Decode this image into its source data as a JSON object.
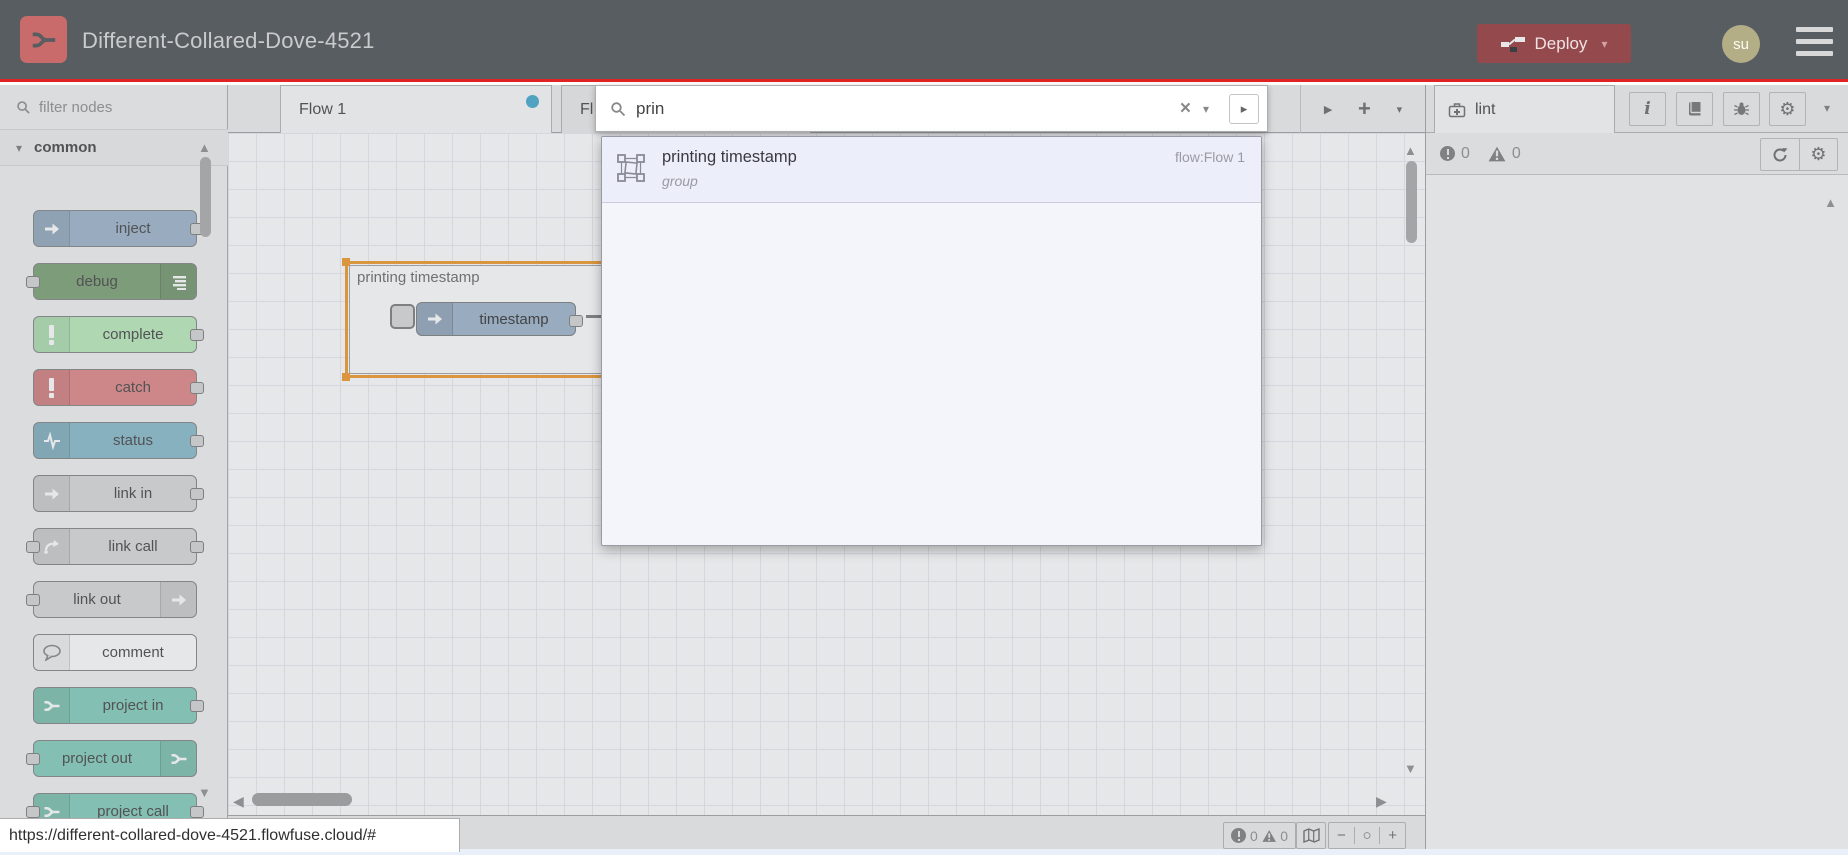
{
  "header": {
    "title": "Different-Collared-Dove-4521",
    "deploy_label": "Deploy",
    "avatar_initials": "su"
  },
  "palette": {
    "filter_placeholder": "filter nodes",
    "category_label": "common",
    "nodes": [
      {
        "label": "inject",
        "color": "#a6bbcf"
      },
      {
        "label": "debug",
        "color": "#87a980"
      },
      {
        "label": "complete",
        "color": "#c0edc0"
      },
      {
        "label": "catch",
        "color": "#e49191"
      },
      {
        "label": "status",
        "color": "#94c1d0"
      },
      {
        "label": "link in",
        "color": "#dddddd"
      },
      {
        "label": "link call",
        "color": "#dddddd"
      },
      {
        "label": "link out",
        "color": "#dddddd"
      },
      {
        "label": "comment",
        "color": "#ffffff"
      },
      {
        "label": "project in",
        "color": "#8ed1c0"
      },
      {
        "label": "project out",
        "color": "#8ed1c0"
      },
      {
        "label": "project call",
        "color": "#8ed1c0"
      }
    ]
  },
  "workspace": {
    "tabs": [
      {
        "label": "Flow 1",
        "unsaved": true
      },
      {
        "label": "Fl"
      }
    ],
    "group": {
      "label": "printing timestamp"
    },
    "node": {
      "label": "timestamp"
    }
  },
  "search": {
    "query": "prin",
    "results": [
      {
        "title": "printing timestamp",
        "type": "group",
        "location": "flow:Flow 1"
      }
    ]
  },
  "sidebar": {
    "tab_label": "lint",
    "error_count": "0",
    "warning_count": "0"
  },
  "canvas_footer": {
    "error_count": "0",
    "warning_count": "0"
  },
  "statusbar": {
    "url": "https://different-collared-dove-4521.flowfuse.cloud/#"
  },
  "icons": {
    "caret_down": "▾",
    "caret_right": "▸",
    "scroll_up": "▲",
    "scroll_down": "▼",
    "scroll_left": "◀",
    "scroll_right": "▶",
    "play": "▶",
    "plus": "+",
    "clear": "×",
    "zoom_out": "−",
    "zoom_reset": "○",
    "zoom_in": "+",
    "gear": "⚙",
    "info": "i"
  },
  "colors": {
    "header_bg": "#585d62",
    "accent_red": "#e02222",
    "logo_red": "#ca6b6b",
    "deploy_bg": "#94494d",
    "avatar_bg": "#b3ae86",
    "group_selection": "#f2a33c",
    "unsaved_dot": "#53b1d2"
  }
}
